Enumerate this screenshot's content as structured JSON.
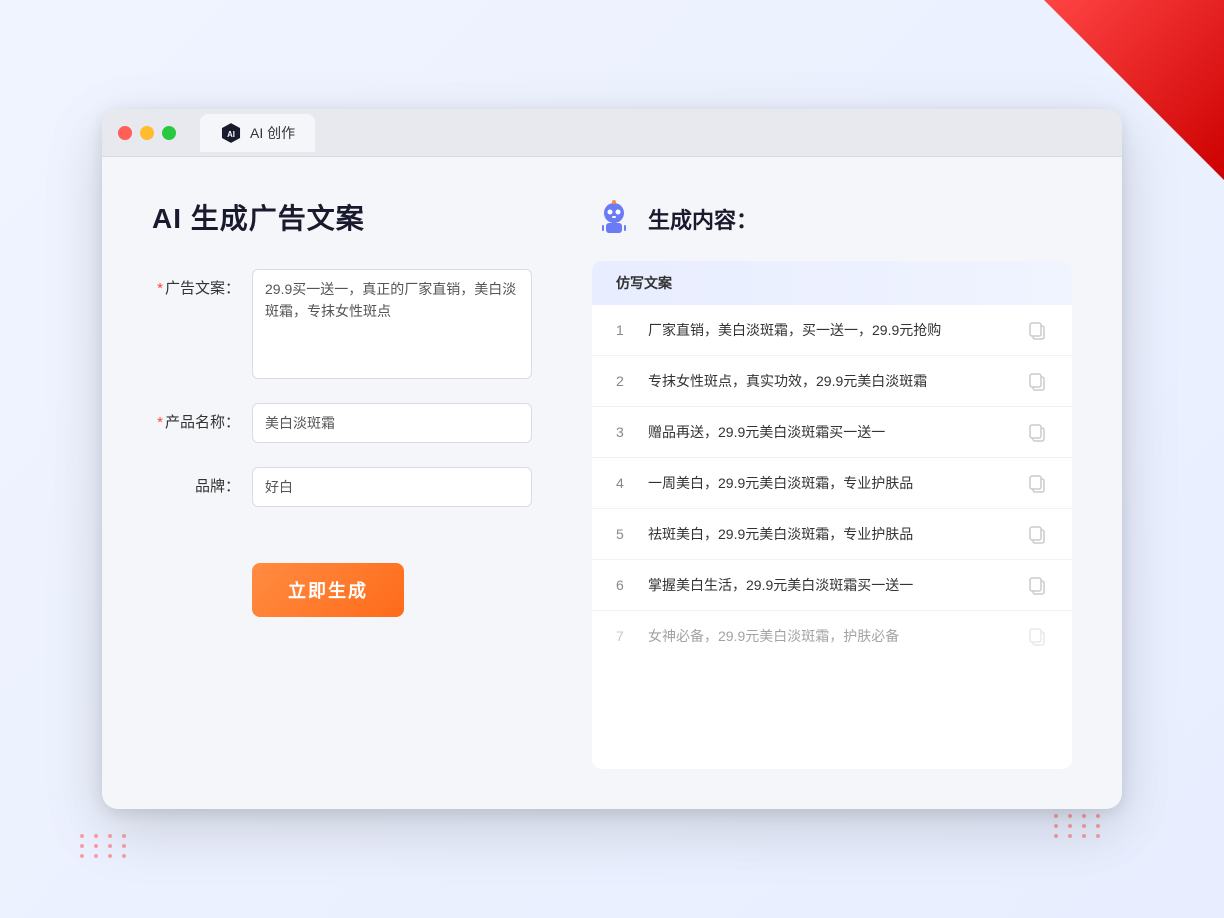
{
  "browser": {
    "tab_label": "AI 创作"
  },
  "page": {
    "title": "AI 生成广告文案",
    "right_title": "生成内容："
  },
  "form": {
    "ad_copy_label": "广告文案：",
    "ad_copy_value": "29.9买一送一，真正的厂家直销，美白淡斑霜，专抹女性斑点",
    "product_name_label": "产品名称：",
    "product_name_value": "美白淡斑霜",
    "brand_label": "品牌：",
    "brand_value": "好白",
    "generate_btn": "立即生成"
  },
  "results": {
    "header": "仿写文案",
    "items": [
      {
        "num": "1",
        "text": "厂家直销，美白淡斑霜，买一送一，29.9元抢购",
        "dimmed": false
      },
      {
        "num": "2",
        "text": "专抹女性斑点，真实功效，29.9元美白淡斑霜",
        "dimmed": false
      },
      {
        "num": "3",
        "text": "赠品再送，29.9元美白淡斑霜买一送一",
        "dimmed": false
      },
      {
        "num": "4",
        "text": "一周美白，29.9元美白淡斑霜，专业护肤品",
        "dimmed": false
      },
      {
        "num": "5",
        "text": "祛斑美白，29.9元美白淡斑霜，专业护肤品",
        "dimmed": false
      },
      {
        "num": "6",
        "text": "掌握美白生活，29.9元美白淡斑霜买一送一",
        "dimmed": false
      },
      {
        "num": "7",
        "text": "女神必备，29.9元美白淡斑霜，护肤必备",
        "dimmed": true
      }
    ]
  }
}
